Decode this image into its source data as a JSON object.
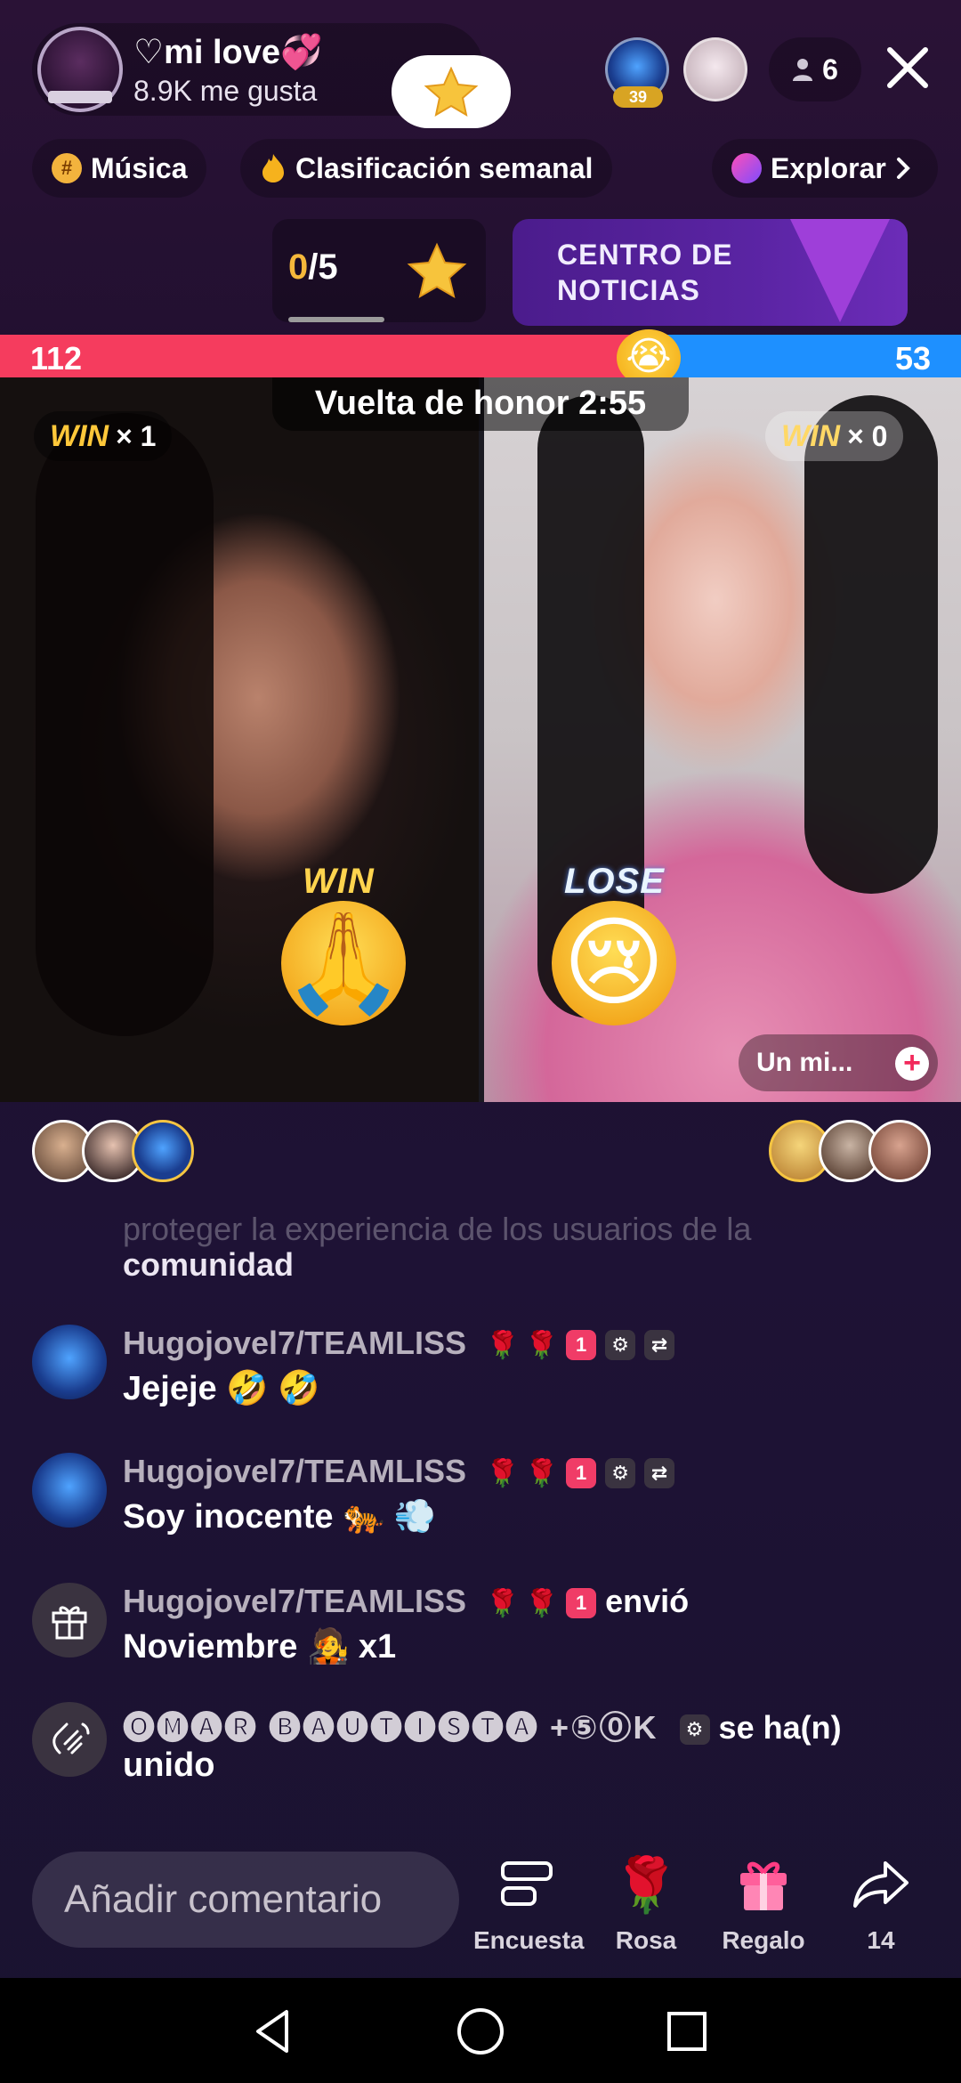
{
  "header": {
    "host_name": "♡mi love💞",
    "host_likes": "8.9K me gusta",
    "top_viewer_level": "39",
    "viewer_count": "6"
  },
  "chips": {
    "music": "Música",
    "weekly_ranking": "Clasificación semanal",
    "explore": "Explorar"
  },
  "goals": {
    "done": "0",
    "total": "/5"
  },
  "news_banner": {
    "title": "CENTRO DE NOTICIAS"
  },
  "battle": {
    "score_left": "112",
    "score_right": "53",
    "left_share": 0.679,
    "timer": "Vuelta de honor 2:55",
    "left_wins_label": "WIN",
    "left_wins_count": "× 1",
    "right_wins_label": "WIN",
    "right_wins_count": "× 0",
    "left_result": "WIN",
    "right_result": "LOSE",
    "guest_name": "Un mi...",
    "colors": {
      "left": "#f53c5e",
      "right": "#1e90ff"
    }
  },
  "chat": {
    "faded_line": "proteger la experiencia de los usuarios de la",
    "continued_line": "comunidad",
    "messages": [
      {
        "username": "Hugojovel7/TEAMLISS",
        "text": "Jejeje 🤣 🤣"
      },
      {
        "username": "Hugojovel7/TEAMLISS",
        "text": "Soy inocente 🐅 💨"
      },
      {
        "username": "Hugojovel7/TEAMLISS",
        "action": "envió",
        "text": "Noviembre 🧑‍🎤 x1"
      },
      {
        "username": "🅞🅜🅐🅡 🅑🅐🅤🅣🅘🅢🅣🅐 +⑤⓪K",
        "action": "se ha(n)",
        "text": "unido"
      }
    ]
  },
  "bottom_bar": {
    "comment_placeholder": "Añadir comentario",
    "poll_label": "Encuesta",
    "rose_label": "Rosa",
    "gift_label": "Regalo",
    "share_count": "14"
  }
}
